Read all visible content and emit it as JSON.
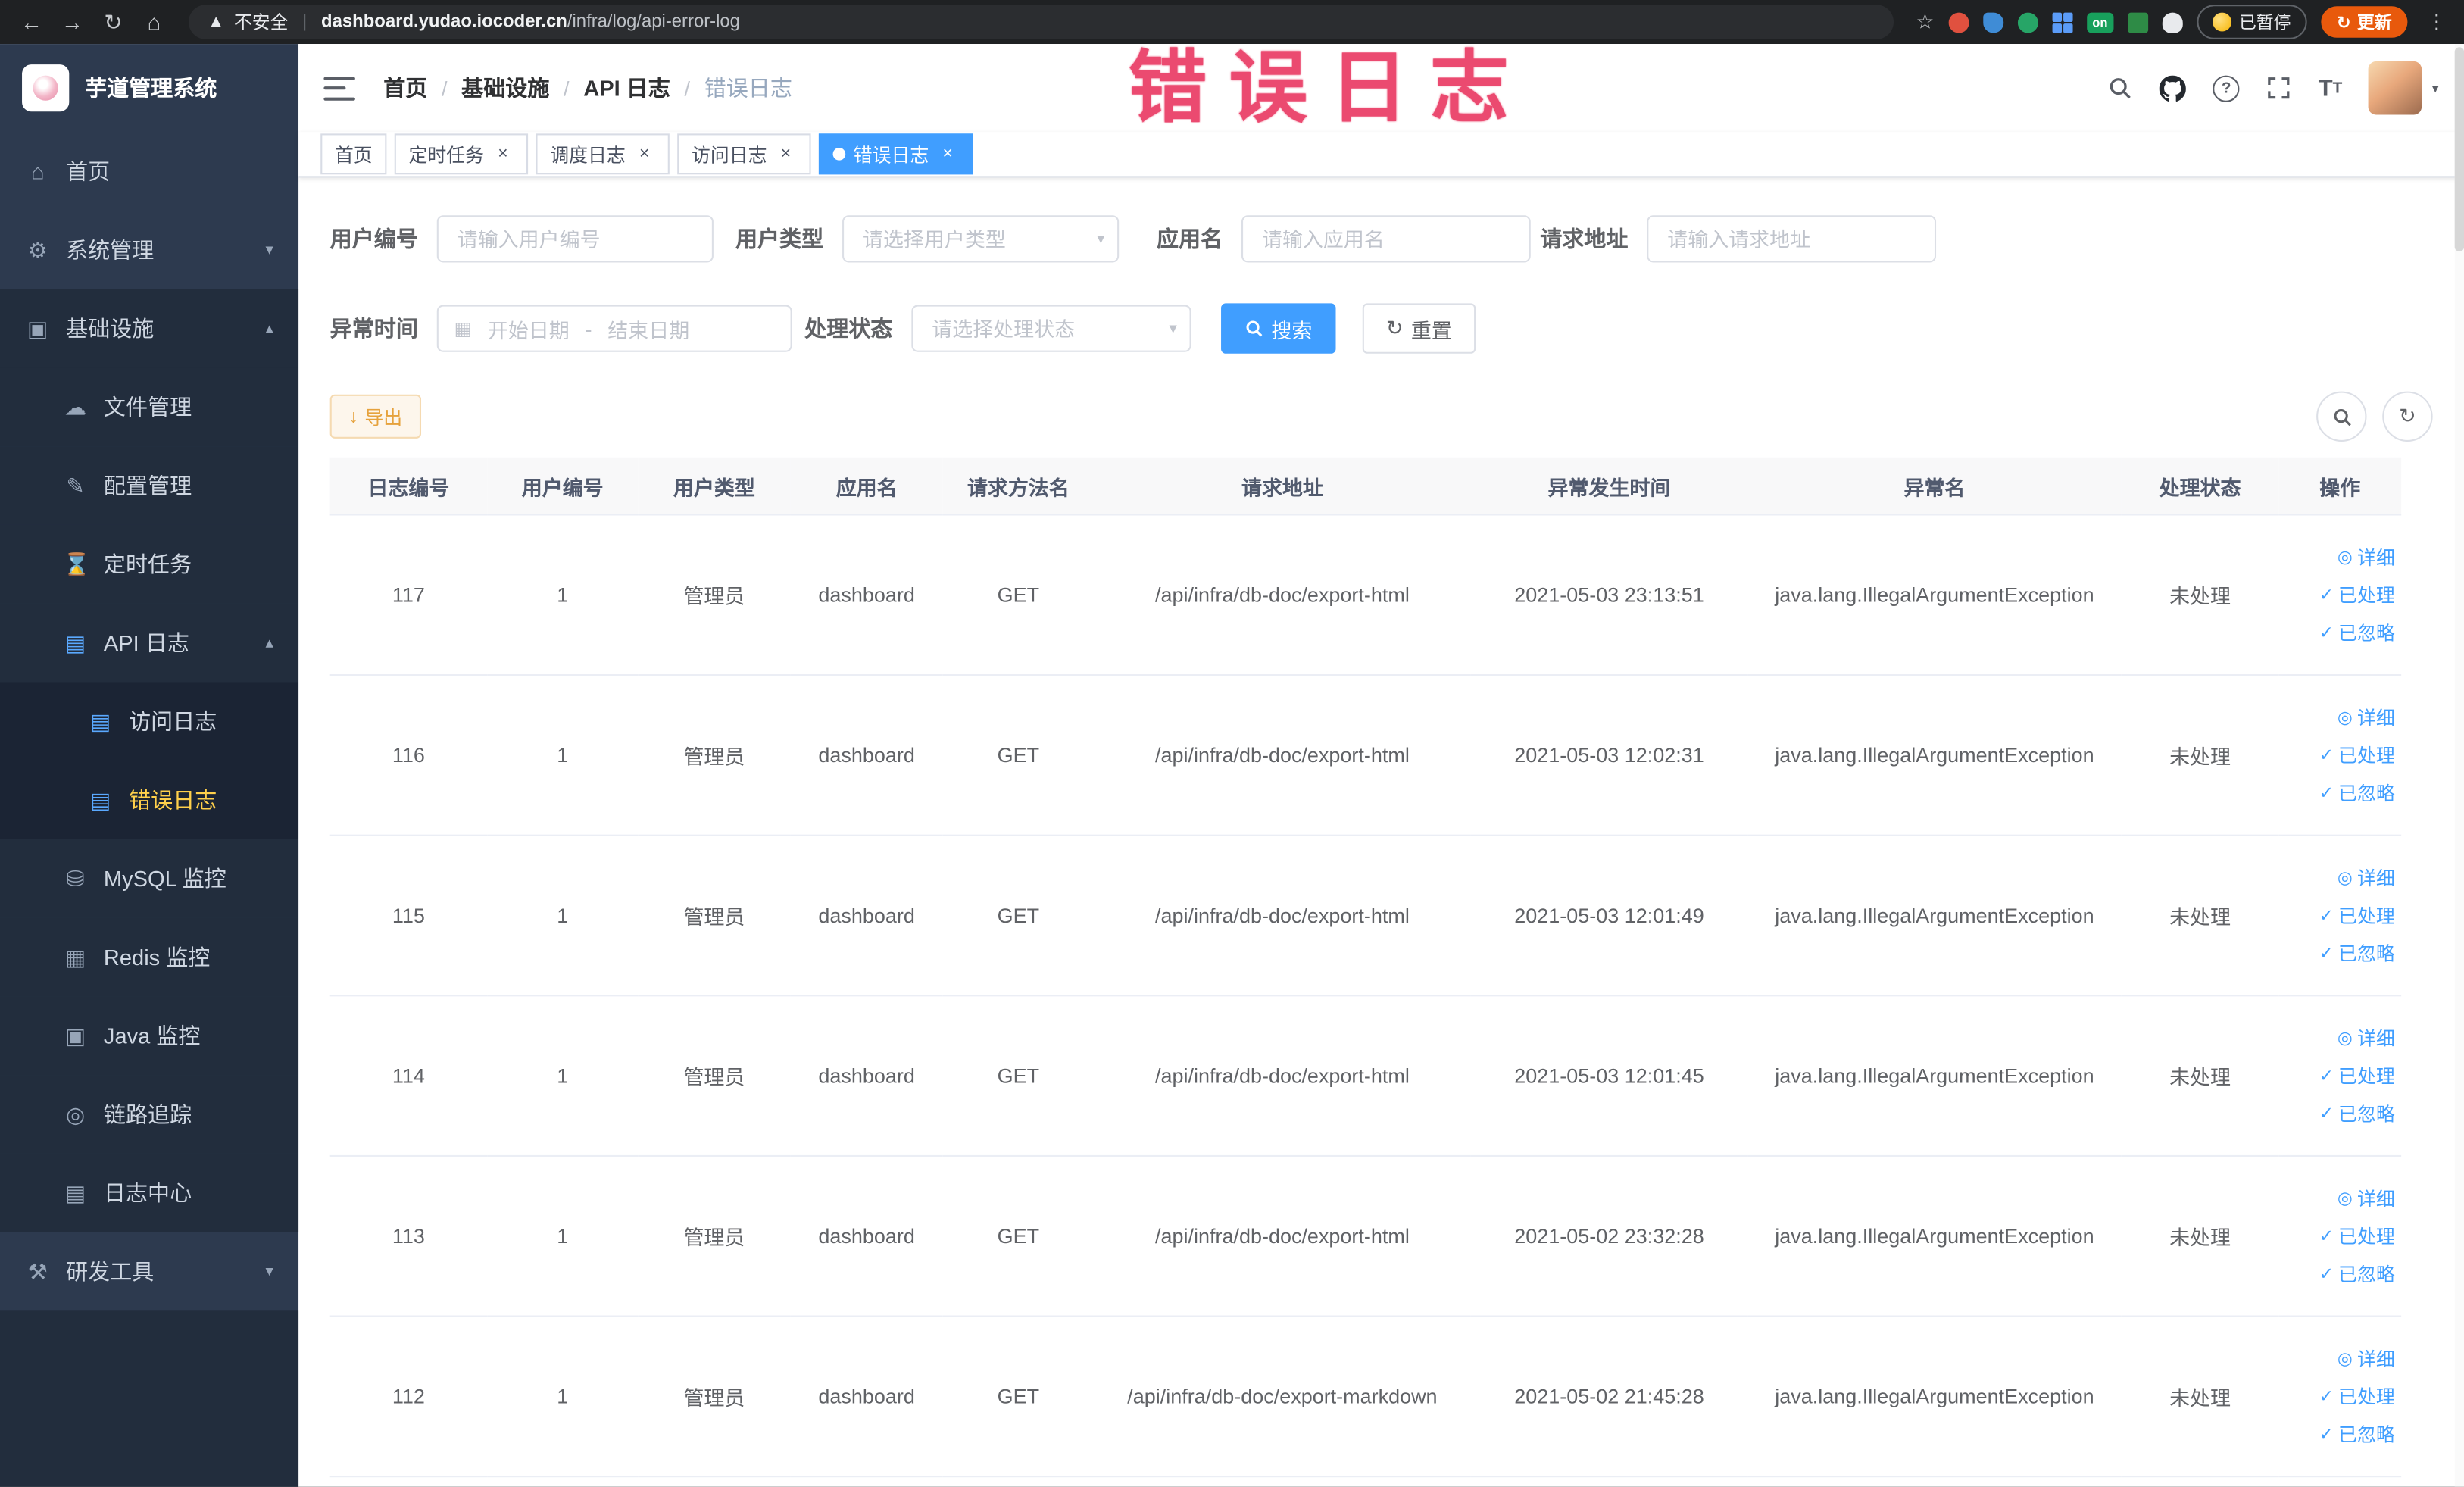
{
  "browser": {
    "security_label": "不安全",
    "url_host": "dashboard.yudao.iocoder.cn",
    "url_path": "/infra/log/api-error-log",
    "extension_on_label": "on",
    "paused_label": "已暂停",
    "update_label": "更新"
  },
  "sidebar": {
    "logo_title": "芋道管理系统",
    "items": {
      "home": "首页",
      "system": "系统管理",
      "infra": "基础设施",
      "file": "文件管理",
      "config": "配置管理",
      "job": "定时任务",
      "api_log": "API 日志",
      "access_log": "访问日志",
      "error_log": "错误日志",
      "mysql": "MySQL 监控",
      "redis": "Redis 监控",
      "java": "Java 监控",
      "trace": "链路追踪",
      "log_center": "日志中心",
      "dev": "研发工具"
    }
  },
  "header": {
    "breadcrumb": [
      "首页",
      "基础设施",
      "API 日志",
      "错误日志"
    ],
    "watermark": "错误日志"
  },
  "tabs": [
    {
      "label": "首页"
    },
    {
      "label": "定时任务"
    },
    {
      "label": "调度日志"
    },
    {
      "label": "访问日志"
    },
    {
      "label": "错误日志"
    }
  ],
  "filters": {
    "user_id_label": "用户编号",
    "user_id_placeholder": "请输入用户编号",
    "user_type_label": "用户类型",
    "user_type_placeholder": "请选择用户类型",
    "app_name_label": "应用名",
    "app_name_placeholder": "请输入应用名",
    "request_url_label": "请求地址",
    "request_url_placeholder": "请输入请求地址",
    "time_label": "异常时间",
    "time_start_placeholder": "开始日期",
    "time_separator": "-",
    "time_end_placeholder": "结束日期",
    "status_label": "处理状态",
    "status_placeholder": "请选择处理状态",
    "search_label": "搜索",
    "reset_label": "重置"
  },
  "toolbar": {
    "export_label": "导出"
  },
  "table": {
    "columns": [
      "日志编号",
      "用户编号",
      "用户类型",
      "应用名",
      "请求方法名",
      "请求地址",
      "异常发生时间",
      "异常名",
      "处理状态",
      "操作"
    ],
    "actions": [
      "详细",
      "已处理",
      "已忽略"
    ],
    "rows": [
      {
        "id": "117",
        "user_id": "1",
        "user_type": "管理员",
        "app": "dashboard",
        "method": "GET",
        "url": "/api/infra/db-doc/export-html",
        "time": "2021-05-03 23:13:51",
        "exception": "java.lang.IllegalArgumentException",
        "status": "未处理"
      },
      {
        "id": "116",
        "user_id": "1",
        "user_type": "管理员",
        "app": "dashboard",
        "method": "GET",
        "url": "/api/infra/db-doc/export-html",
        "time": "2021-05-03 12:02:31",
        "exception": "java.lang.IllegalArgumentException",
        "status": "未处理"
      },
      {
        "id": "115",
        "user_id": "1",
        "user_type": "管理员",
        "app": "dashboard",
        "method": "GET",
        "url": "/api/infra/db-doc/export-html",
        "time": "2021-05-03 12:01:49",
        "exception": "java.lang.IllegalArgumentException",
        "status": "未处理"
      },
      {
        "id": "114",
        "user_id": "1",
        "user_type": "管理员",
        "app": "dashboard",
        "method": "GET",
        "url": "/api/infra/db-doc/export-html",
        "time": "2021-05-03 12:01:45",
        "exception": "java.lang.IllegalArgumentException",
        "status": "未处理"
      },
      {
        "id": "113",
        "user_id": "1",
        "user_type": "管理员",
        "app": "dashboard",
        "method": "GET",
        "url": "/api/infra/db-doc/export-html",
        "time": "2021-05-02 23:32:28",
        "exception": "java.lang.IllegalArgumentException",
        "status": "未处理"
      },
      {
        "id": "112",
        "user_id": "1",
        "user_type": "管理员",
        "app": "dashboard",
        "method": "GET",
        "url": "/api/infra/db-doc/export-markdown",
        "time": "2021-05-02 21:45:28",
        "exception": "java.lang.IllegalArgumentException",
        "status": "未处理"
      }
    ]
  },
  "colors": {
    "accent": "#409eff",
    "warning": "#e6a23c",
    "watermark": "#eb4a70",
    "sidebar_bg": "#2d3a4f",
    "sidebar_active": "#ffd04b"
  }
}
